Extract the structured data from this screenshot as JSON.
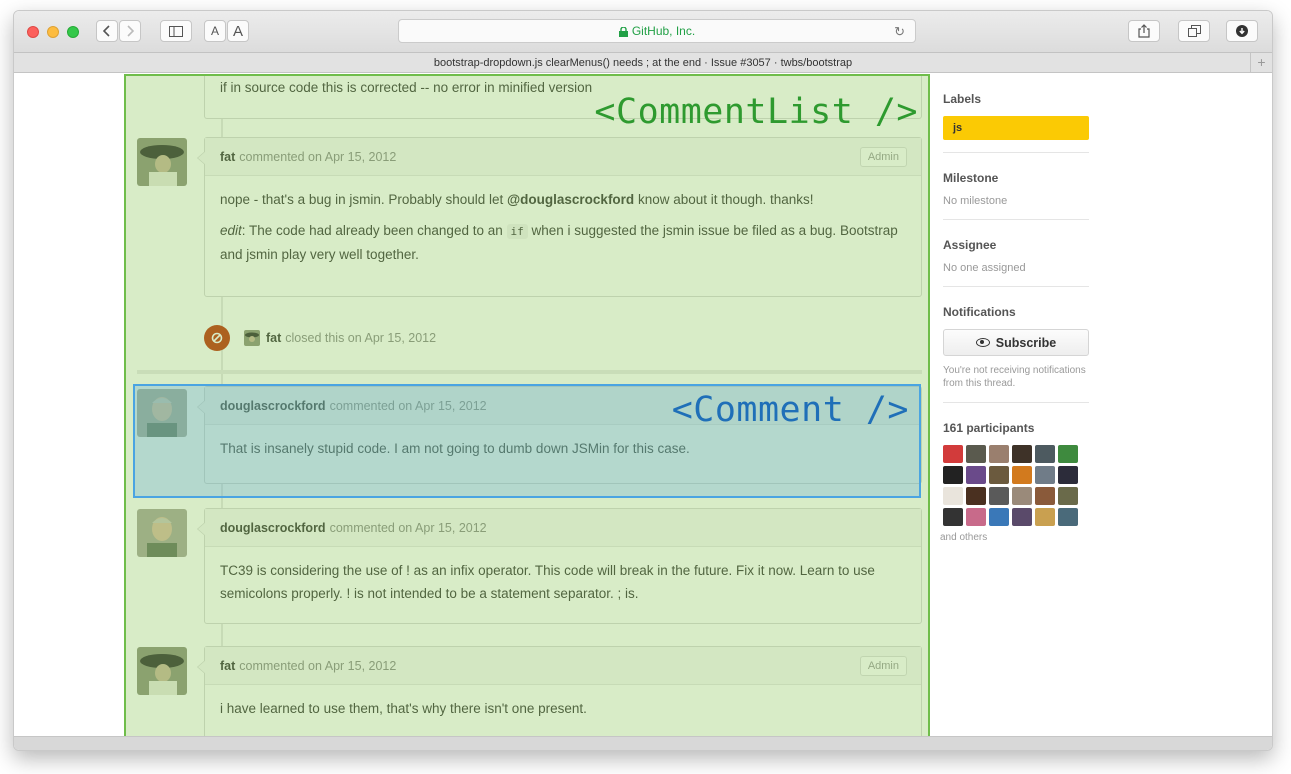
{
  "browser": {
    "address": "GitHub, Inc.",
    "tab_title": "bootstrap-dropdown.js clearMenus() needs ; at the end · Issue #3057 · twbs/bootstrap",
    "font_small": "A",
    "font_large": "A",
    "new_tab": "+"
  },
  "overlays": {
    "comment_list": "<CommentList />",
    "comment": "<Comment />"
  },
  "comments": [
    {
      "author": "",
      "meta": "",
      "paragraphs": [
        "if in source code this is corrected -- no error in minified version"
      ]
    },
    {
      "author": "fat",
      "meta": "commented on Apr 15, 2012",
      "badge": "Admin",
      "p1_before": "nope - that's a bug in jsmin. Probably should let ",
      "p1_mention": "@douglascrockford",
      "p1_after": " know about it though. thanks!",
      "p2_em": "edit",
      "p2_before": ": The code had already been changed to an ",
      "p2_code": "if",
      "p2_after": " when i suggested the jsmin issue be filed as a bug. Bootstrap and jsmin play very well together."
    },
    {
      "author": "douglascrockford",
      "meta": "commented on Apr 15, 2012",
      "body": "That is insanely stupid code. I am not going to dumb down JSMin for this case."
    },
    {
      "author": "douglascrockford",
      "meta": "commented on Apr 15, 2012",
      "body": "TC39 is considering the use of ! as an infix operator. This code will break in the future. Fix it now. Learn to use semicolons properly. ! is not intended to be a statement separator. ; is."
    },
    {
      "author": "fat",
      "meta": "commented on Apr 15, 2012",
      "badge": "Admin",
      "body": "i have learned to use them, that's why there isn't one present."
    }
  ],
  "event": {
    "author": "fat",
    "text": "closed this on Apr 15, 2012"
  },
  "sidebar": {
    "labels_title": "Labels",
    "label": "js",
    "label_color": "#fbca04",
    "milestone_title": "Milestone",
    "milestone_value": "No milestone",
    "assignee_title": "Assignee",
    "assignee_value": "No one assigned",
    "notifications_title": "Notifications",
    "subscribe_label": "Subscribe",
    "notifications_note": "You're not receiving notifications from this thread.",
    "participants_title": "161 participants",
    "others": "and others"
  }
}
